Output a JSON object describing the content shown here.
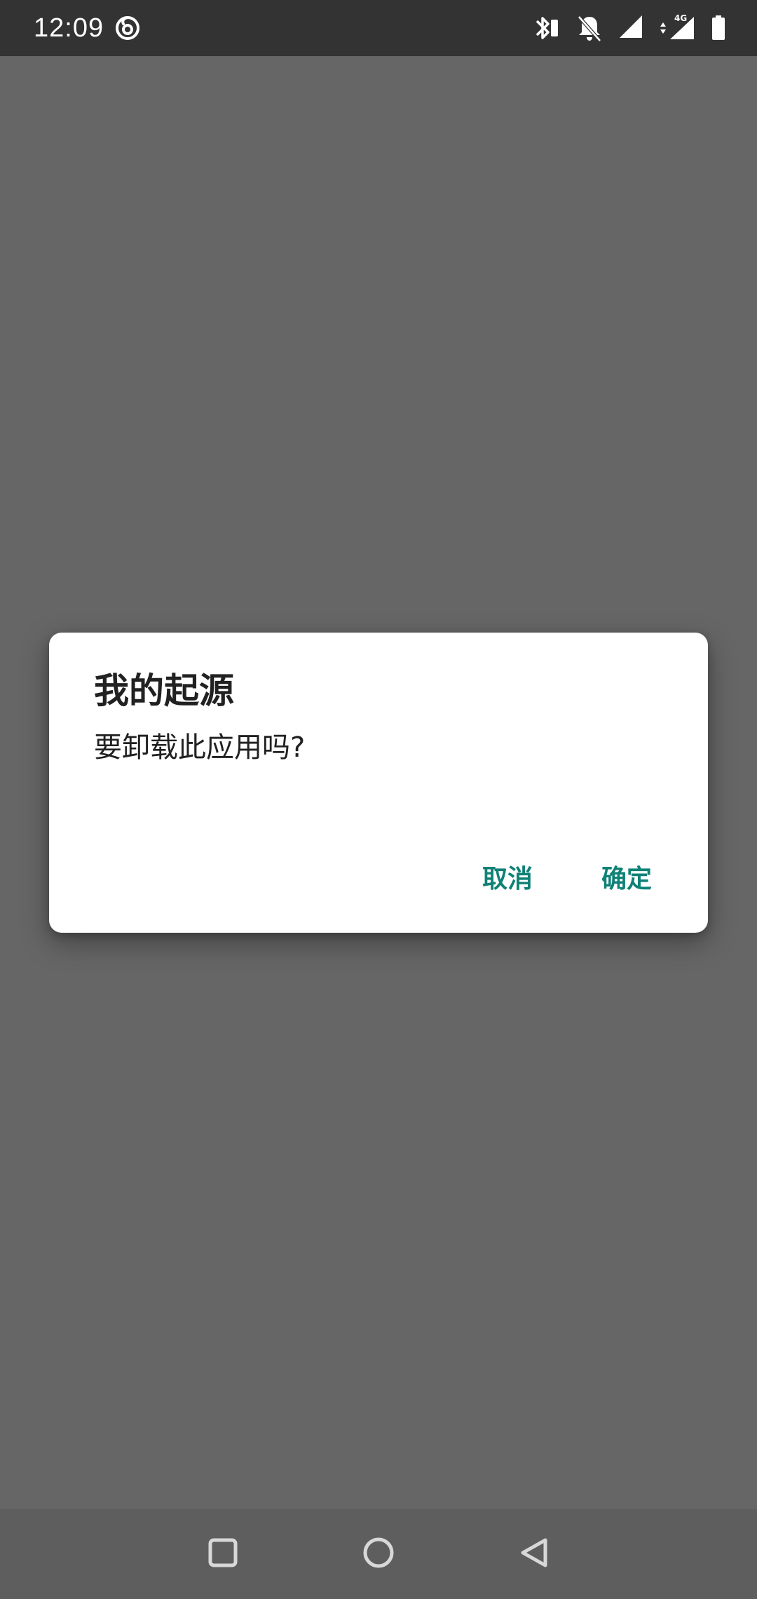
{
  "status_bar": {
    "time": "12:09",
    "app_icon": "netease-music-icon",
    "network_label": "4G",
    "icons": [
      "bluetooth-icon",
      "notifications-off-icon",
      "wifi-signal-icon",
      "cellular-signal-icon",
      "battery-icon"
    ]
  },
  "dialog": {
    "title": "我的起源",
    "message": "要卸载此应用吗?",
    "cancel_label": "取消",
    "ok_label": "确定"
  },
  "nav_bar": {
    "recent_icon": "square-recents-icon",
    "home_icon": "circle-home-icon",
    "back_icon": "triangle-back-icon"
  },
  "colors": {
    "scrim": "#666666",
    "status_bar": "#333333",
    "nav_bar": "#5e5e5e",
    "accent": "#0f8177",
    "dialog_bg": "#ffffff",
    "text": "#212121"
  }
}
